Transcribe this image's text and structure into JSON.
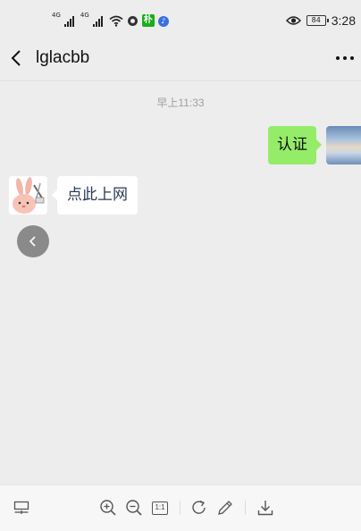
{
  "status_bar": {
    "net1": "4G",
    "net2": "4G",
    "badge_text": "朴",
    "battery": "84",
    "time": "3:28"
  },
  "header": {
    "title": "lglacbb"
  },
  "messages": {
    "timestamp": "早上11:33",
    "sent_text": "认证",
    "received_text": "点此上网"
  },
  "toolbar": {
    "ratio_label": "1:1"
  },
  "colors": {
    "background": "#ededed",
    "sent_bubble": "#95ec69",
    "received_bubble": "#ffffff",
    "link_text": "#2b3a55"
  }
}
